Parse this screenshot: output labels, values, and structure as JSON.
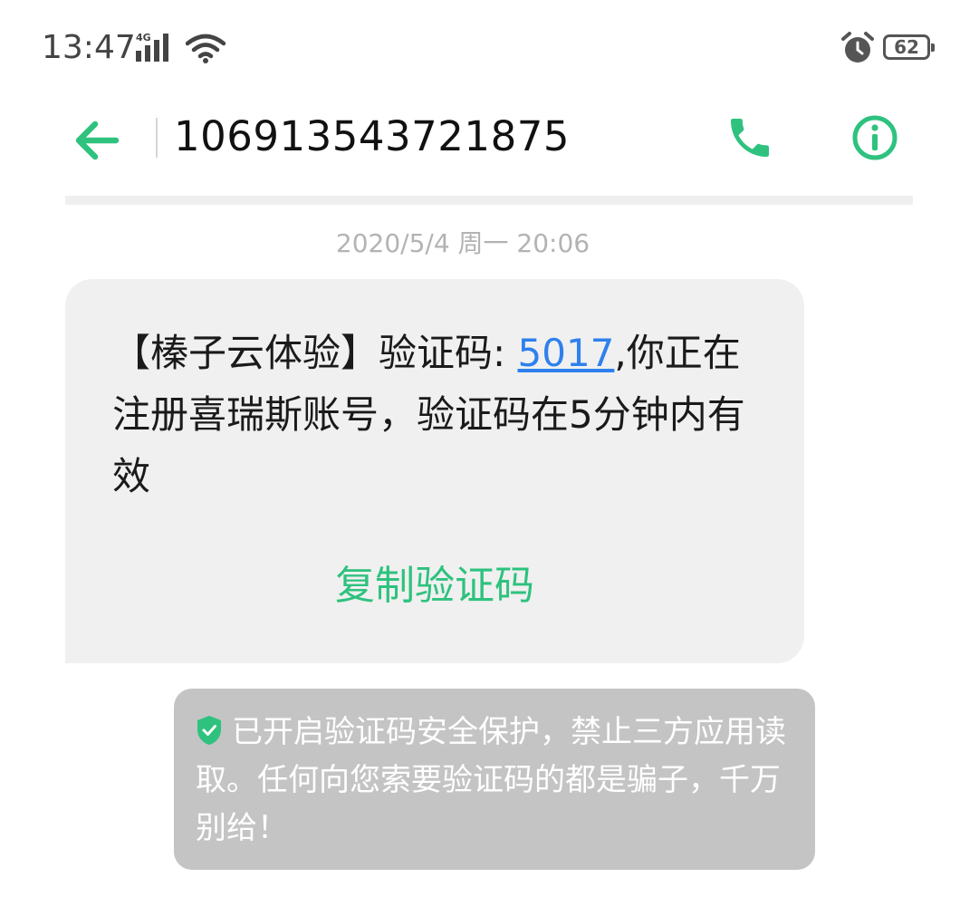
{
  "status_bar": {
    "time": "13:47",
    "network": "4G",
    "battery": "62",
    "icons": [
      "signal-icon",
      "wifi-icon",
      "alarm-icon",
      "battery-icon"
    ]
  },
  "header": {
    "sender": "106913543721875",
    "icons": [
      "back-arrow-icon",
      "phone-icon",
      "info-icon"
    ],
    "accent_color": "#2ec27e"
  },
  "conversation": {
    "date": "2020/5/4 周一 20:06",
    "message": {
      "prefix": "【榛子云体验】验证码: ",
      "code": "5017",
      "suffix": ",你正在注册喜瑞斯账号，验证码在5分钟内有效"
    },
    "copy_button": "复制验证码"
  },
  "security_notice": {
    "text": "已开启验证码安全保护，禁止三方应用读取。任何向您索要验证码的都是骗子，千万别给！"
  }
}
